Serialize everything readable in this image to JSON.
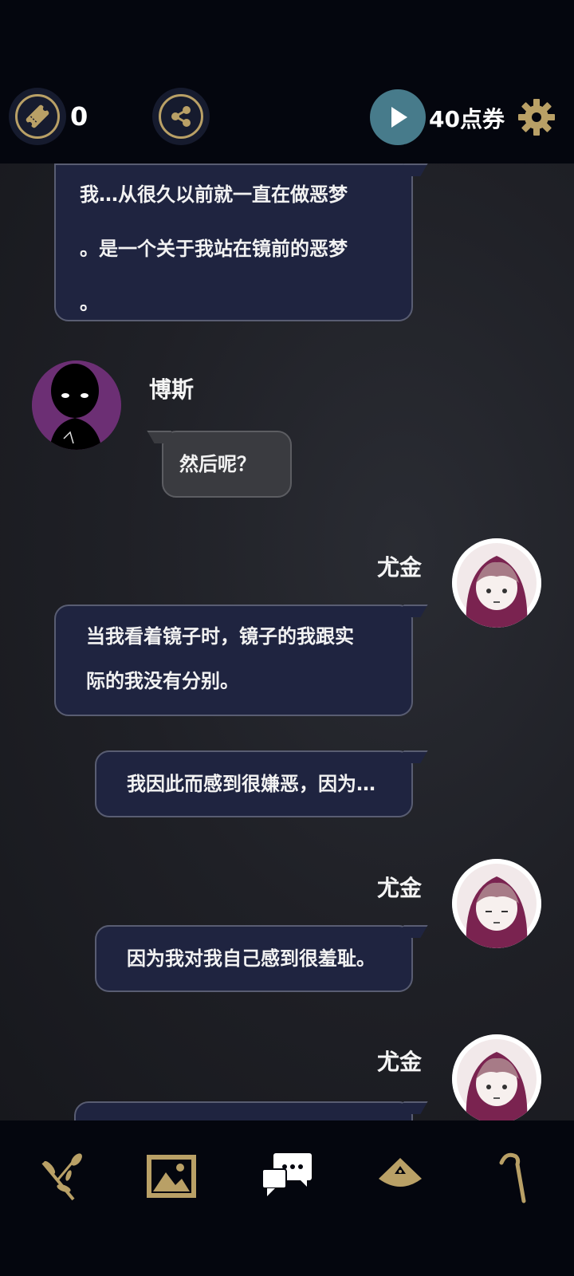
{
  "topbar": {
    "ticket_count": "0",
    "points_label": "40点券",
    "icons": [
      "ticket-icon",
      "share-icon",
      "play-icon",
      "gear-icon"
    ]
  },
  "chat": {
    "messages": [
      {
        "speaker": "",
        "lines": [
          "我…从很久以前就一直在做恶梦",
          "。是一个关于我站在镜前的恶梦",
          "。"
        ]
      },
      {
        "speaker": "博斯",
        "lines": [
          "然后呢？"
        ]
      },
      {
        "speaker": "尤金",
        "lines": [
          "当我看着镜子时，镜子的我跟实",
          "际的我没有分别。"
        ]
      },
      {
        "speaker": "",
        "lines": [
          "我因此而感到很嫌恶，因为…"
        ]
      },
      {
        "speaker": "尤金",
        "lines": [
          "因为我对我自己感到很羞耻。"
        ]
      },
      {
        "speaker": "尤金",
        "lines": [
          ""
        ]
      }
    ]
  },
  "bottomnav": {
    "items": [
      "branch-icon",
      "gallery-icon",
      "chat-icon",
      "hat-icon",
      "cane-icon"
    ]
  },
  "colors": {
    "accent_gold": "#b9a066",
    "play_teal": "#477b8b",
    "bubble_navy": "#1f2440",
    "boss_purple": "#6c2f74"
  }
}
